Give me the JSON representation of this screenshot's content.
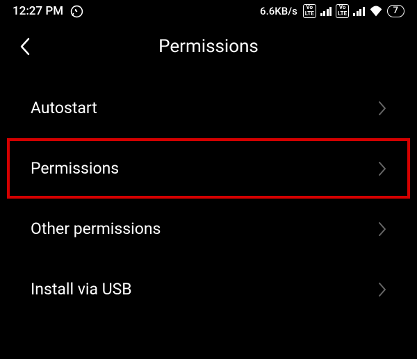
{
  "status_bar": {
    "time": "12:27 PM",
    "net_speed": "6.6KB/s",
    "volte_top": "Vo",
    "volte_bottom": "LTE",
    "battery_level": "7"
  },
  "header": {
    "title": "Permissions"
  },
  "menu": {
    "items": [
      {
        "label": "Autostart"
      },
      {
        "label": "Permissions"
      },
      {
        "label": "Other permissions"
      },
      {
        "label": "Install via USB"
      }
    ]
  }
}
